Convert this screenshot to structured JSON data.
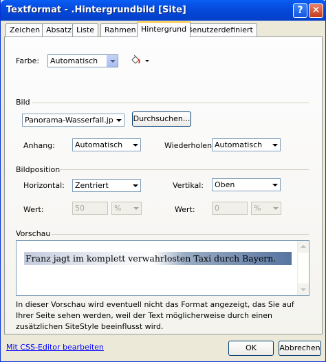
{
  "window": {
    "title": "Textformat - .Hintergrundbild [Site]",
    "help_glyph": "?",
    "close_glyph": "✕"
  },
  "tabs": [
    {
      "label": "Zeichen"
    },
    {
      "label": "Absatz"
    },
    {
      "label": "Liste"
    },
    {
      "label": "Rahmen"
    },
    {
      "label": "Hintergrund"
    },
    {
      "label": "Benutzerdefiniert"
    }
  ],
  "farbe": {
    "label": "Farbe:",
    "value": "Automatisch"
  },
  "bild": {
    "section_label": "Bild",
    "file_value": "Panorama-Wasserfall.jpg",
    "browse_label": "Durchsuchen...",
    "anhang_label": "Anhang:",
    "anhang_value": "Automatisch",
    "wiederholen_label": "Wiederholen:",
    "wiederholen_value": "Automatisch"
  },
  "bildposition": {
    "section_label": "Bildposition",
    "horizontal_label": "Horizontal:",
    "horizontal_value": "Zentriert",
    "vertikal_label": "Vertikal:",
    "vertikal_value": "Oben",
    "wert_label_left": "Wert:",
    "wert_value_left": "50",
    "unit_left": "%",
    "wert_label_right": "Wert:",
    "wert_value_right": "0",
    "unit_right": "%"
  },
  "vorschau": {
    "section_label": "Vorschau",
    "sample_text": "Franz jagt im komplett verwahrlosten Taxi durch Bayern."
  },
  "note": "In dieser Vorschau wird eventuell nicht das Format angezeigt, das Sie auf Ihrer Seite sehen werden, weil der Text möglicherweise durch einen zusätzlichen SiteStyle beeinflusst wird.",
  "footer": {
    "css_link": "Mit CSS-Editor bearbeiten",
    "ok_label": "OK",
    "cancel_label": "Abbrechen"
  }
}
